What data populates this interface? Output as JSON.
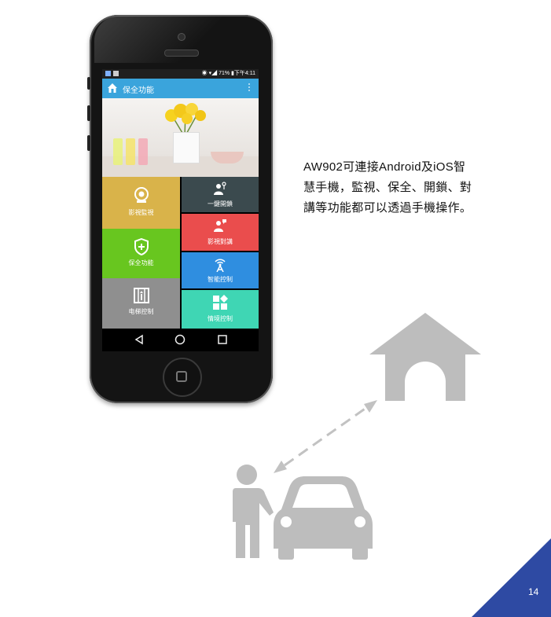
{
  "status_bar": {
    "battery": "71%",
    "time": "下午4:11"
  },
  "app": {
    "title": "保全功能",
    "tiles": [
      {
        "id": "video-monitor",
        "label": "影視監視",
        "color": "#d9b34a",
        "icon": "camera-icon"
      },
      {
        "id": "one-key-unlock",
        "label": "一鍵開鎖",
        "color": "#3b4a4e",
        "icon": "key-person-icon"
      },
      {
        "id": "video-intercom",
        "label": "影視對講",
        "color": "#ea4d4d",
        "icon": "intercom-person-icon"
      },
      {
        "id": "security",
        "label": "保全功能",
        "color": "#68c61f",
        "icon": "shield-plus-icon"
      },
      {
        "id": "smart-control",
        "label": "智能控制",
        "color": "#2f8ee0",
        "icon": "antenna-icon"
      },
      {
        "id": "elevator",
        "label": "电梯控制",
        "color": "#8f8f8f",
        "icon": "elevator-icon"
      },
      {
        "id": "scene",
        "label": "情境控制",
        "color": "#3fd6b4",
        "icon": "grid-shapes-icon"
      }
    ]
  },
  "description": {
    "line1": "AW902可連接Android及iOS智",
    "line2": "慧手機，監視、保全、開鎖、對",
    "line3": "講等功能都可以透過手機操作。"
  },
  "page_number": "14",
  "colors": {
    "illustration_gray": "#bdbdbd",
    "corner_blue": "#2e4aa3"
  }
}
